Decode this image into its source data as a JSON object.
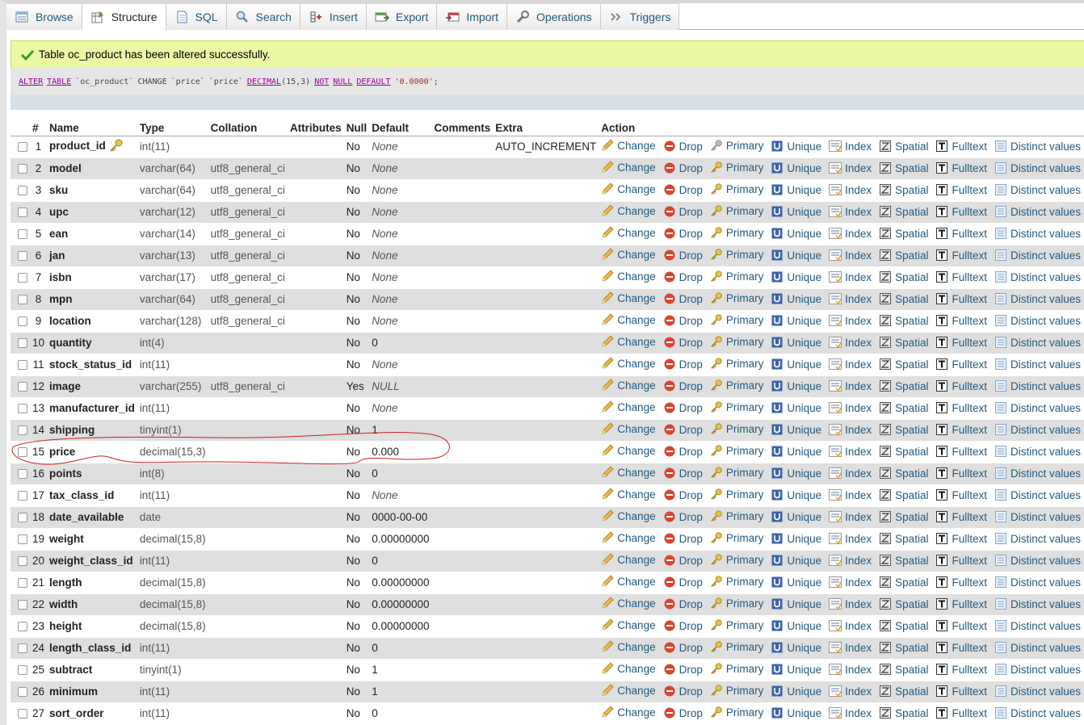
{
  "tabs": [
    {
      "label": "Browse",
      "icon": "browse-icon",
      "active": false
    },
    {
      "label": "Structure",
      "icon": "structure-icon",
      "active": true
    },
    {
      "label": "SQL",
      "icon": "sql-icon",
      "active": false
    },
    {
      "label": "Search",
      "icon": "search-icon",
      "active": false
    },
    {
      "label": "Insert",
      "icon": "insert-icon",
      "active": false
    },
    {
      "label": "Export",
      "icon": "export-icon",
      "active": false
    },
    {
      "label": "Import",
      "icon": "import-icon",
      "active": false
    },
    {
      "label": "Operations",
      "icon": "operations-icon",
      "active": false
    },
    {
      "label": "Triggers",
      "icon": "triggers-icon",
      "active": false
    }
  ],
  "message": {
    "text": "Table oc_product has been altered successfully.",
    "sql": "ALTER TABLE `oc_product` CHANGE `price` `price` DECIMAL(15,3) NOT NULL DEFAULT '0.0000';"
  },
  "columns": {
    "num": "#",
    "name": "Name",
    "type": "Type",
    "collation": "Collation",
    "attributes": "Attributes",
    "null": "Null",
    "default": "Default",
    "comments": "Comments",
    "extra": "Extra",
    "action": "Action"
  },
  "actions": {
    "change": "Change",
    "drop": "Drop",
    "primary": "Primary",
    "unique": "Unique",
    "index": "Index",
    "spatial": "Spatial",
    "fulltext": "Fulltext",
    "distinct": "Distinct values"
  },
  "rows": [
    {
      "num": "1",
      "name": "product_id",
      "type": "int(11)",
      "collation": "",
      "null": "No",
      "default": "None",
      "extra": "AUTO_INCREMENT",
      "primary_key": true
    },
    {
      "num": "2",
      "name": "model",
      "type": "varchar(64)",
      "collation": "utf8_general_ci",
      "null": "No",
      "default": "None",
      "extra": ""
    },
    {
      "num": "3",
      "name": "sku",
      "type": "varchar(64)",
      "collation": "utf8_general_ci",
      "null": "No",
      "default": "None",
      "extra": ""
    },
    {
      "num": "4",
      "name": "upc",
      "type": "varchar(12)",
      "collation": "utf8_general_ci",
      "null": "No",
      "default": "None",
      "extra": ""
    },
    {
      "num": "5",
      "name": "ean",
      "type": "varchar(14)",
      "collation": "utf8_general_ci",
      "null": "No",
      "default": "None",
      "extra": ""
    },
    {
      "num": "6",
      "name": "jan",
      "type": "varchar(13)",
      "collation": "utf8_general_ci",
      "null": "No",
      "default": "None",
      "extra": ""
    },
    {
      "num": "7",
      "name": "isbn",
      "type": "varchar(17)",
      "collation": "utf8_general_ci",
      "null": "No",
      "default": "None",
      "extra": ""
    },
    {
      "num": "8",
      "name": "mpn",
      "type": "varchar(64)",
      "collation": "utf8_general_ci",
      "null": "No",
      "default": "None",
      "extra": ""
    },
    {
      "num": "9",
      "name": "location",
      "type": "varchar(128)",
      "collation": "utf8_general_ci",
      "null": "No",
      "default": "None",
      "extra": ""
    },
    {
      "num": "10",
      "name": "quantity",
      "type": "int(4)",
      "collation": "",
      "null": "No",
      "default": "0",
      "extra": ""
    },
    {
      "num": "11",
      "name": "stock_status_id",
      "type": "int(11)",
      "collation": "",
      "null": "No",
      "default": "None",
      "extra": ""
    },
    {
      "num": "12",
      "name": "image",
      "type": "varchar(255)",
      "collation": "utf8_general_ci",
      "null": "Yes",
      "default": "NULL",
      "extra": ""
    },
    {
      "num": "13",
      "name": "manufacturer_id",
      "type": "int(11)",
      "collation": "",
      "null": "No",
      "default": "None",
      "extra": ""
    },
    {
      "num": "14",
      "name": "shipping",
      "type": "tinyint(1)",
      "collation": "",
      "null": "No",
      "default": "1",
      "extra": ""
    },
    {
      "num": "15",
      "name": "price",
      "type": "decimal(15,3)",
      "collation": "",
      "null": "No",
      "default": "0.000",
      "extra": ""
    },
    {
      "num": "16",
      "name": "points",
      "type": "int(8)",
      "collation": "",
      "null": "No",
      "default": "0",
      "extra": ""
    },
    {
      "num": "17",
      "name": "tax_class_id",
      "type": "int(11)",
      "collation": "",
      "null": "No",
      "default": "None",
      "extra": ""
    },
    {
      "num": "18",
      "name": "date_available",
      "type": "date",
      "collation": "",
      "null": "No",
      "default": "0000-00-00",
      "extra": ""
    },
    {
      "num": "19",
      "name": "weight",
      "type": "decimal(15,8)",
      "collation": "",
      "null": "No",
      "default": "0.00000000",
      "extra": ""
    },
    {
      "num": "20",
      "name": "weight_class_id",
      "type": "int(11)",
      "collation": "",
      "null": "No",
      "default": "0",
      "extra": ""
    },
    {
      "num": "21",
      "name": "length",
      "type": "decimal(15,8)",
      "collation": "",
      "null": "No",
      "default": "0.00000000",
      "extra": ""
    },
    {
      "num": "22",
      "name": "width",
      "type": "decimal(15,8)",
      "collation": "",
      "null": "No",
      "default": "0.00000000",
      "extra": ""
    },
    {
      "num": "23",
      "name": "height",
      "type": "decimal(15,8)",
      "collation": "",
      "null": "No",
      "default": "0.00000000",
      "extra": ""
    },
    {
      "num": "24",
      "name": "length_class_id",
      "type": "int(11)",
      "collation": "",
      "null": "No",
      "default": "0",
      "extra": ""
    },
    {
      "num": "25",
      "name": "subtract",
      "type": "tinyint(1)",
      "collation": "",
      "null": "No",
      "default": "1",
      "extra": ""
    },
    {
      "num": "26",
      "name": "minimum",
      "type": "int(11)",
      "collation": "",
      "null": "No",
      "default": "1",
      "extra": ""
    },
    {
      "num": "27",
      "name": "sort_order",
      "type": "int(11)",
      "collation": "",
      "null": "No",
      "default": "0",
      "extra": ""
    }
  ],
  "colors": {
    "link": "#235a81",
    "success_bg": "#ebf8a4",
    "row_even": "#dfdfdf",
    "annotation": "#cc2222"
  }
}
